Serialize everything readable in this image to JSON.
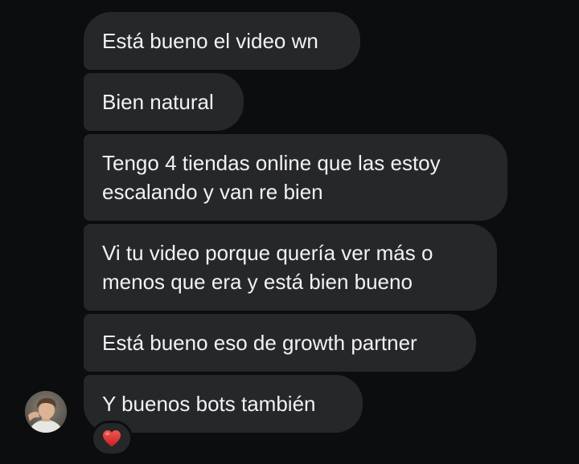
{
  "messages": [
    {
      "lines": [
        "Está bueno el video wn"
      ]
    },
    {
      "lines": [
        "Bien natural"
      ]
    },
    {
      "lines": [
        "Tengo 4 tiendas online que las estoy",
        "escalando y van re bien"
      ]
    },
    {
      "lines": [
        "Vi tu video porque quería ver más o",
        "menos que era y está bien bueno"
      ]
    },
    {
      "lines": [
        "Está bueno eso de growth partner"
      ]
    },
    {
      "lines": [
        "Y buenos bots también"
      ]
    }
  ],
  "sender": {
    "avatar_icon": "avatar-photo"
  },
  "reaction": {
    "emoji_icon": "red-heart-icon",
    "color": "#e0322f"
  },
  "colors": {
    "background": "#0c0d0f",
    "bubble": "#262729",
    "text": "#f2f2f2"
  }
}
